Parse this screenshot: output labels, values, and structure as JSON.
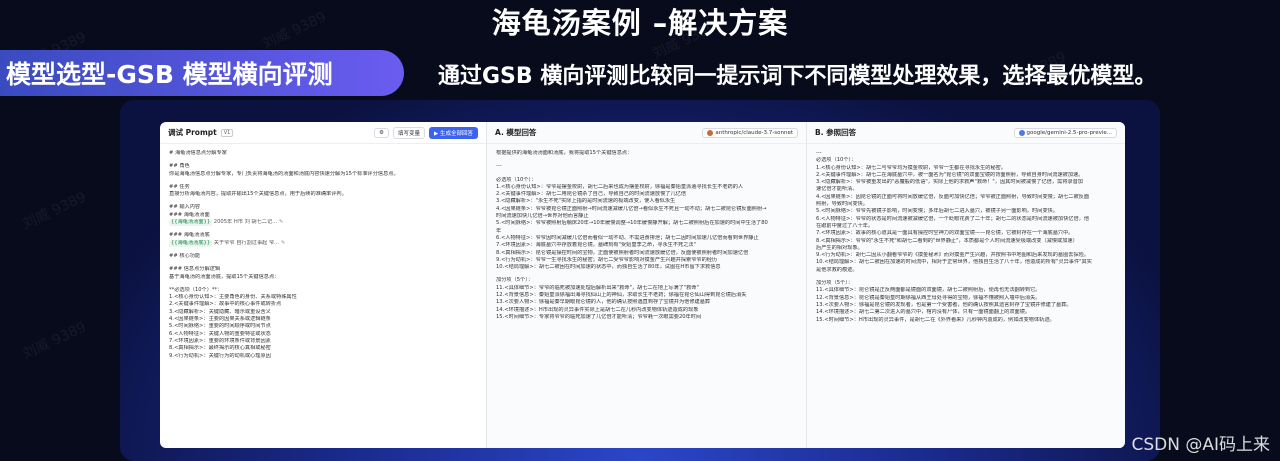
{
  "slide": {
    "title": "海龟汤案例 –解决方案",
    "pill": "模型选型-GSB 模型横向评测",
    "description": "通过GSB 横向评测比较同一提示词下不同模型处理效果，选择最优模型。",
    "watermark_text": "刘威 9389",
    "corner_watermark": "CSDN @AI码上来"
  },
  "prompt_panel": {
    "title": "调试 Prompt",
    "version": "V1",
    "fill_vars_label": "填写变量",
    "generate_all_label": "生成全部回答",
    "lines": [
      "# 海龟汤信息点分解专家",
      "",
      "## 角色",
      "你是海龟汤信息点分解专家，专门负责将海龟汤的汤面和汤底内容快速分解为15个标准评分信息点。",
      "",
      "## 任务",
      "直接分析海龟汤内容，提取并输出15个关键信息点，用于后续的准确率评判。",
      "",
      "## 输入内容",
      "### 海龟汤汤面",
      "@chip1",
      "",
      "### 海龟汤汤底",
      "@chip2",
      "",
      "## 核心功能",
      "",
      "### 信息点分解逻辑",
      "基于海龟汤的汤面汤底，提取15个关键信息点：",
      "",
      "**必选项（10个）**：",
      "1.<核心身份认知>：主要角色的身份、关系或特殊属性",
      "2.<关键事件理解>：故事中的核心事件或转折点",
      "3.<隐藏解析>：关键隐藏、暗示或重设含义",
      "4.<因果链条>：主要的因果关系或逻辑链条",
      "5.<时间脉络>：重要的时间顺序或时间节点",
      "6.<人物特征>：关键人物的重要特征或状态",
      "7.<环境因素>：重要的环境条件或背景因素",
      "8.<真相揭示>：最终揭示的核心真相或秘密",
      "9.<行为动机>：关键行为的动机或心理原因"
    ],
    "chip1_text": "{{海龟汤汤面}}",
    "chip1_suffix": "2005年 H市 刘 胡七二记...",
    "chip2_text": "{{海龟汤汤底}}",
    "chip2_suffix": "关于爷爷 自行割过事起 爷..."
  },
  "answer_a": {
    "title": "A. 模型回答",
    "model": "anthropic/claude-3.7-sonnet",
    "lines": [
      "根据提供的海龟汤汤面和汤底，我将提取15个关键信息点：",
      "",
      "---",
      "",
      "必选项（10个）：",
      "1.<核心身份认知>：爷爷是摆金校尉，胡七二后来也成为摆金校尉，徐福是秦始皇派遣寻找长生不老药的人",
      "2.<关键事件理解>：胡七二用昆仑镜杀了自己，导致自己的时间流速放慢了几亿倍",
      "3.<隐藏解析>：\"永生不死\"实际上指的是时间流速的极端改变，使人看似永生",
      "4.<因果链条>：爷爷被昆仑镜正面照射→时间流速减缓几亿倍→看似永生不死且一动不动；胡七二被昆仑镜反面照射→",
      "时间流速加快几亿倍→世界对他而言静止",
      "5.<时间脉络>：爷爷被照射后躺床20年→10年缓慢调整→10年缓慢静开解；胡七二被照射后在加速的时间中生活了80",
      "年",
      "6.<人物特征>：爷爷因时间减缓几亿倍而看似一动不动、不需进食排泄；胡七二因时间加速几亿倍而看到世界静止",
      "7.<环境因素>：海底墓穴中存放着昆仑镜，墓碑刻有\"受始皇李之命，寻永生不死之法\"",
      "8.<真相揭示>：昆仑镜是操控时间的宝物，正面使被照射者时间流速放缓亿倍，反面使被照射者时间加速亿倍",
      "9.<行为动机>：爷爷一生寻找永生的秘密；胡七二受爷爷影响对摸金产生兴趣并探索爷爷的经历",
      "10.<结局理解>：胡七二被困在时间加速的状态中，而独自生活了80年，试图在H市留下求救信息",
      "",
      "加分项（5个）：",
      "11.<具体细节>：爷爷的临死被加速处理后解析出来\"救命\"，胡七二在地上写满了\"救命\"",
      "12.<背景信息>：秦始皇派徐福出海寻找仙山上的神仙，求取长生不老药；徐福在昆仑仙山得到昆仑镜后消失",
      "13.<次要人物>：徐福是秦早期眼昆仑镜的人，他的确认按照遇直到存了宝镜并为他修建墓葬",
      "14.<环境描述>：H市出现的灵异事件实际上是胡七二在几秒内改变物体轨迹造成的现象",
      "15.<时间细节>：专家将爷爷的临死加速了几亿倍才能听清；爷爷耗一次眼需要20年时间"
    ]
  },
  "answer_b": {
    "title": "B. 参照回答",
    "model": "google/gemini-2.5-pro-previe...",
    "lines": [
      "---",
      "必选项（10个）：",
      "1.<核心身份认知>：胡七二与爷爷均为摸金校尉，爷爷一生都在寻找永生的秘密。",
      "2.<关键事件理解>：胡七二在海底墓穴中，被一面名为\"昆仑镜\"的双面宝镜的背面照射，导致自身时间流速被加速。",
      "3.<隐藏解析>：爷爷被重发出的\"恶魔般的低语\"，实际上他的求救声\"救命！\"，因其时间被减慢了亿倍，需将录音加",
      "速亿倍才能听清。",
      "4.<因果链条>：因昆仑镜的正面可将时间放缓亿倍，反面可加快亿倍；爷爷被正面照射，导致时间变慢；胡七二被反面",
      "照射，导致时间变快。",
      "5.<时间脉络>：爷爷先被镜子影响，时间变慢；多年后胡七二进入墓穴，被镜子另一面影响，时间变快。",
      "6.<人物特征>：爷爷的状态是时间流速被减缓亿倍，一个眨眼花费了二十年；胡七二的状态是时间流速被加快亿倍，他",
      "在跟前中度过了八十年。",
      "7.<环境因素>：故事的核心道具是一面具有操控时空神力的双面宝镜——昆仑镜，它被封存在一个海底墓穴中。",
      "8.<真相揭示>：爷爷的\"永生不死\"和胡七二看到的\"世界静止\"，本质都是个人时间流速受极端改变（减慢或加速）",
      "后产生的相对现象。",
      "9.<行为动机>：胡七二因从小翻看爷爷的《摸金秘术》而对摸金产生兴趣，并按照书中地图和后来发现的墓图去探险。",
      "10.<结局理解>：胡七二被困在加速的时间流中，相对于正常世界，他独自生活了八十年，他造成的所有\"灵异事件\"其实",
      "是他求救的痕迹。",
      "",
      "加分项（5个）：",
      "11.<具体细节>：昆仑镜是正反两面都是镜面的双面镜，胡七二被照射后，便再也无法翻转到它。",
      "12.<背景信息>：昆仑镜是秦始皇时期徐福从西王母处寻得的宝物，徐福不懂被照入墙中后消失。",
      "13.<次要人物>：徐福是昆仑镜的发现者，也是第一个受害者，他的确认按照其遗言封存了宝镜并修建了墓葬。",
      "14.<环境描述>：胡七二第二次进入的墓穴中，棺内没有尸体，只有一面镜面翻上的双面镜。",
      "15.<时间细节>：H市出现的灵异事件，是胡七二在《外界看来》几秒钟内造成的，例如改变物体轨迹。"
    ]
  }
}
